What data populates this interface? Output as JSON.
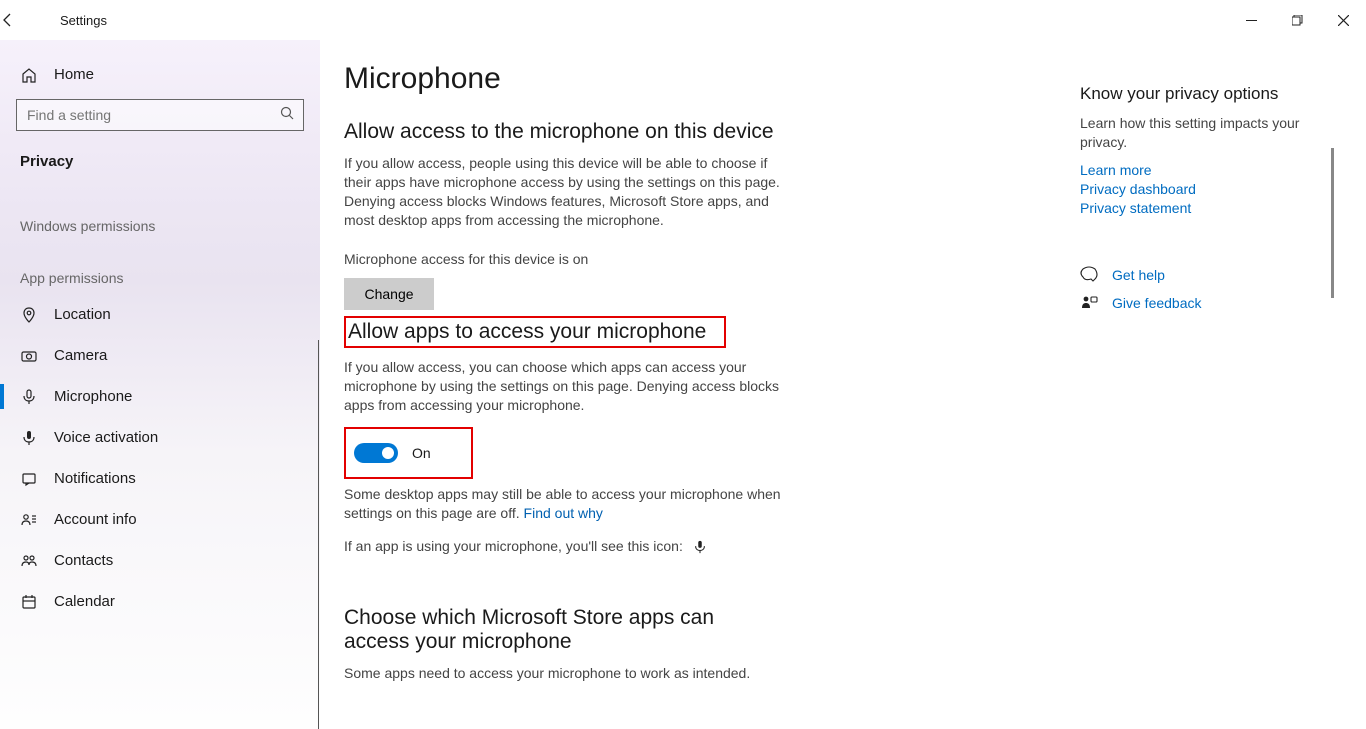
{
  "titlebar": {
    "title": "Settings"
  },
  "sidebar": {
    "home": "Home",
    "search_placeholder": "Find a setting",
    "heading": "Privacy",
    "section1": "Windows permissions",
    "section2": "App permissions",
    "items": [
      {
        "label": "Location"
      },
      {
        "label": "Camera"
      },
      {
        "label": "Microphone"
      },
      {
        "label": "Voice activation"
      },
      {
        "label": "Notifications"
      },
      {
        "label": "Account info"
      },
      {
        "label": "Contacts"
      },
      {
        "label": "Calendar"
      }
    ]
  },
  "main": {
    "page_title": "Microphone",
    "sec1_title": "Allow access to the microphone on this device",
    "sec1_body": "If you allow access, people using this device will be able to choose if their apps have microphone access by using the settings on this page. Denying access blocks Windows features, Microsoft Store apps, and most desktop apps from accessing the microphone.",
    "sec1_status": "Microphone access for this device is on",
    "change": "Change",
    "sec2_title": "Allow apps to access your microphone",
    "sec2_body": "If you allow access, you can choose which apps can access your microphone by using the settings on this page. Denying access blocks apps from accessing your microphone.",
    "toggle_state": "On",
    "sec2_note_a": "Some desktop apps may still be able to access your microphone when settings on this page are off. ",
    "sec2_note_link": "Find out why",
    "sec2_icon_note": "If an app is using your microphone, you'll see this icon:",
    "sec3_title": "Choose which Microsoft Store apps can access your microphone",
    "sec3_body": "Some apps need to access your microphone to work as intended."
  },
  "right": {
    "heading": "Know your privacy options",
    "body": "Learn how this setting impacts your privacy.",
    "links": [
      "Learn more",
      "Privacy dashboard",
      "Privacy statement"
    ],
    "help": "Get help",
    "feedback": "Give feedback"
  }
}
